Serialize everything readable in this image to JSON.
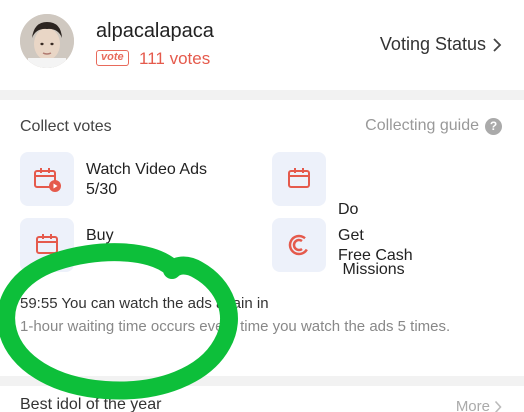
{
  "profile": {
    "username": "alpacalapaca",
    "vote_badge": "vote",
    "vote_count": "111 votes",
    "voting_status_label": "Voting Status"
  },
  "collect": {
    "title": "Collect votes",
    "guide_label": "Collecting guide",
    "tasks": [
      {
        "label": "Watch Video Ads",
        "sub": "5/30",
        "icon": "video-ad-icon"
      },
      {
        "label": "Do",
        "sub": " Missions",
        "icon": "missions-icon"
      },
      {
        "label": "Buy",
        "sub": "",
        "icon": "buy-icon"
      },
      {
        "label": "Get",
        "sub": "Free Cash",
        "icon": "free-cash-icon"
      }
    ],
    "wait_main": "59:55 You can watch the ads again in",
    "wait_note": "1-hour waiting time occurs every time you watch the ads 5 times."
  },
  "best": {
    "title": "Best idol of the year",
    "more_label": "More"
  },
  "colors": {
    "accent": "#e55a4c",
    "highlight_marker": "#0dbf3a",
    "icon_bg": "#edf1fa"
  }
}
